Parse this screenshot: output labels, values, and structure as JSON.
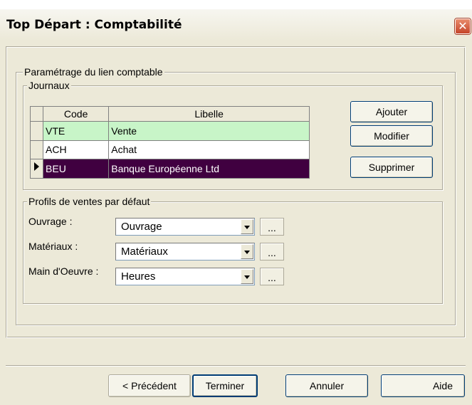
{
  "window": {
    "title": "Top Départ : Comptabilité",
    "close_glyph": "✕"
  },
  "settings_group": {
    "label": "Paramétrage du lien comptable"
  },
  "journals": {
    "label": "Journaux",
    "columns": [
      "Code",
      "Libelle"
    ],
    "rows": [
      {
        "code": "VTE",
        "libelle": "Vente",
        "color": "#c8f5c8"
      },
      {
        "code": "ACH",
        "libelle": "Achat",
        "color": "#ffffff"
      },
      {
        "code": "BEU",
        "libelle": "Banque Européenne Ltd",
        "color": "#400040",
        "selected": true
      }
    ],
    "buttons": {
      "add": "Ajouter",
      "edit": "Modifier",
      "delete": "Supprimer"
    }
  },
  "sales_profiles": {
    "label": "Profils de ventes par défaut",
    "fields": [
      {
        "label": "Ouvrage :",
        "value": "Ouvrage",
        "more": "..."
      },
      {
        "label": "Matériaux :",
        "value": "Matériaux",
        "more": "..."
      },
      {
        "label": "Main d'Oeuvre :",
        "value": "Heures",
        "more": "..."
      }
    ]
  },
  "footer": {
    "previous": "< Précédent",
    "finish": "Terminer",
    "cancel": "Annuler",
    "help": "Aide"
  },
  "icons": {
    "row_selector": "triangle-right",
    "dropdown": "chevron-down-icon",
    "close": "close-icon"
  }
}
